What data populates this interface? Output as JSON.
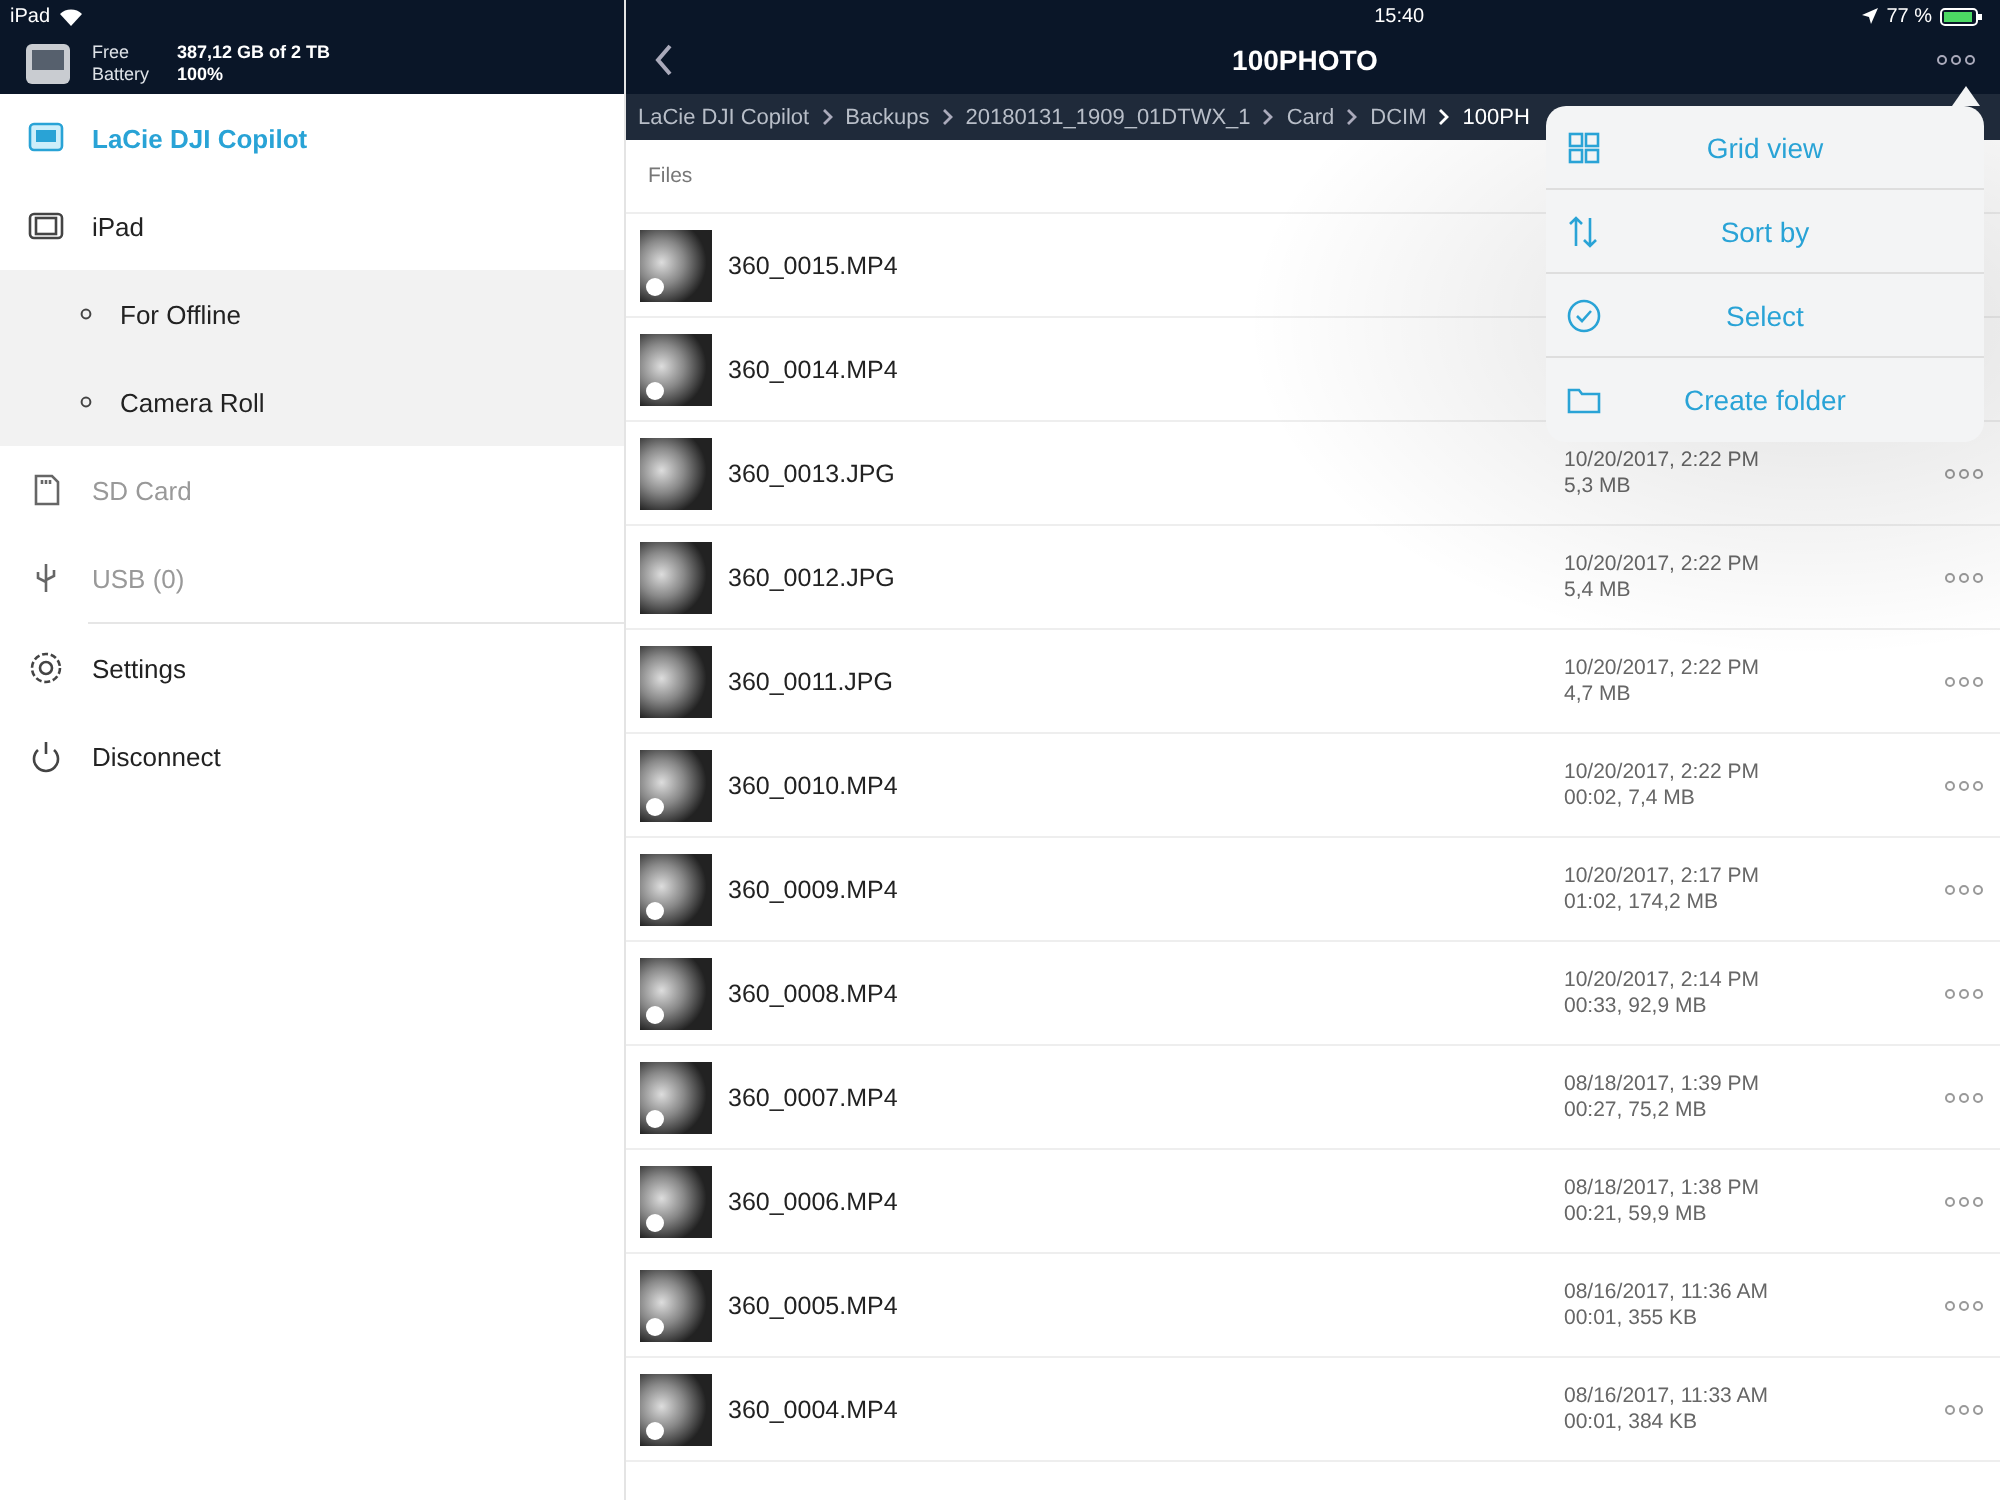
{
  "status_bar": {
    "device": "iPad",
    "time": "15:40",
    "battery": "77 %"
  },
  "device_info": {
    "free_label": "Free",
    "free_value": "387,12 GB of 2 TB",
    "battery_label": "Battery",
    "battery_value": "100%"
  },
  "sidebar": {
    "items": [
      {
        "kind": "drive",
        "label": "LaCie DJI Copilot",
        "selected": true,
        "disabled": false
      },
      {
        "kind": "ipad",
        "label": "iPad",
        "selected": false,
        "disabled": false,
        "children": [
          {
            "label": "For Offline"
          },
          {
            "label": "Camera Roll"
          }
        ]
      },
      {
        "kind": "sd",
        "label": "SD Card",
        "selected": false,
        "disabled": true
      },
      {
        "kind": "usb",
        "label": "USB (0)",
        "selected": false,
        "disabled": true
      },
      {
        "kind": "divider"
      },
      {
        "kind": "settings",
        "label": "Settings",
        "selected": false,
        "disabled": false
      },
      {
        "kind": "power",
        "label": "Disconnect",
        "selected": false,
        "disabled": false
      }
    ]
  },
  "nav": {
    "title": "100PHOTO"
  },
  "breadcrumb": [
    "LaCie DJI Copilot",
    "Backups",
    "20180131_1909_01DTWX_1",
    "Card",
    "DCIM",
    "100PH"
  ],
  "files": {
    "section": "Files",
    "rows": [
      {
        "kind": "video",
        "name": "360_0015.MP4"
      },
      {
        "kind": "video",
        "name": "360_0014.MP4"
      },
      {
        "kind": "photo",
        "name": "360_0013.JPG",
        "date": "10/20/2017, 2:22 PM",
        "info": "5,3 MB"
      },
      {
        "kind": "photo",
        "name": "360_0012.JPG",
        "date": "10/20/2017, 2:22 PM",
        "info": "5,4 MB"
      },
      {
        "kind": "photo",
        "name": "360_0011.JPG",
        "date": "10/20/2017, 2:22 PM",
        "info": "4,7 MB"
      },
      {
        "kind": "video",
        "name": "360_0010.MP4",
        "date": "10/20/2017, 2:22 PM",
        "info": "00:02, 7,4 MB"
      },
      {
        "kind": "video",
        "name": "360_0009.MP4",
        "date": "10/20/2017, 2:17 PM",
        "info": "01:02, 174,2 MB"
      },
      {
        "kind": "video",
        "name": "360_0008.MP4",
        "date": "10/20/2017, 2:14 PM",
        "info": "00:33, 92,9 MB"
      },
      {
        "kind": "video",
        "name": "360_0007.MP4",
        "date": "08/18/2017, 1:39 PM",
        "info": "00:27, 75,2 MB"
      },
      {
        "kind": "video",
        "name": "360_0006.MP4",
        "date": "08/18/2017, 1:38 PM",
        "info": "00:21, 59,9 MB"
      },
      {
        "kind": "video",
        "name": "360_0005.MP4",
        "date": "08/16/2017, 11:36 AM",
        "info": "00:01, 355 KB"
      },
      {
        "kind": "video",
        "name": "360_0004.MP4",
        "date": "08/16/2017, 11:33 AM",
        "info": "00:01, 384 KB"
      }
    ]
  },
  "menu": {
    "items": [
      {
        "kind": "grid",
        "label": "Grid view"
      },
      {
        "kind": "sort",
        "label": "Sort by"
      },
      {
        "kind": "select",
        "label": "Select"
      },
      {
        "kind": "folder",
        "label": "Create folder"
      }
    ]
  }
}
